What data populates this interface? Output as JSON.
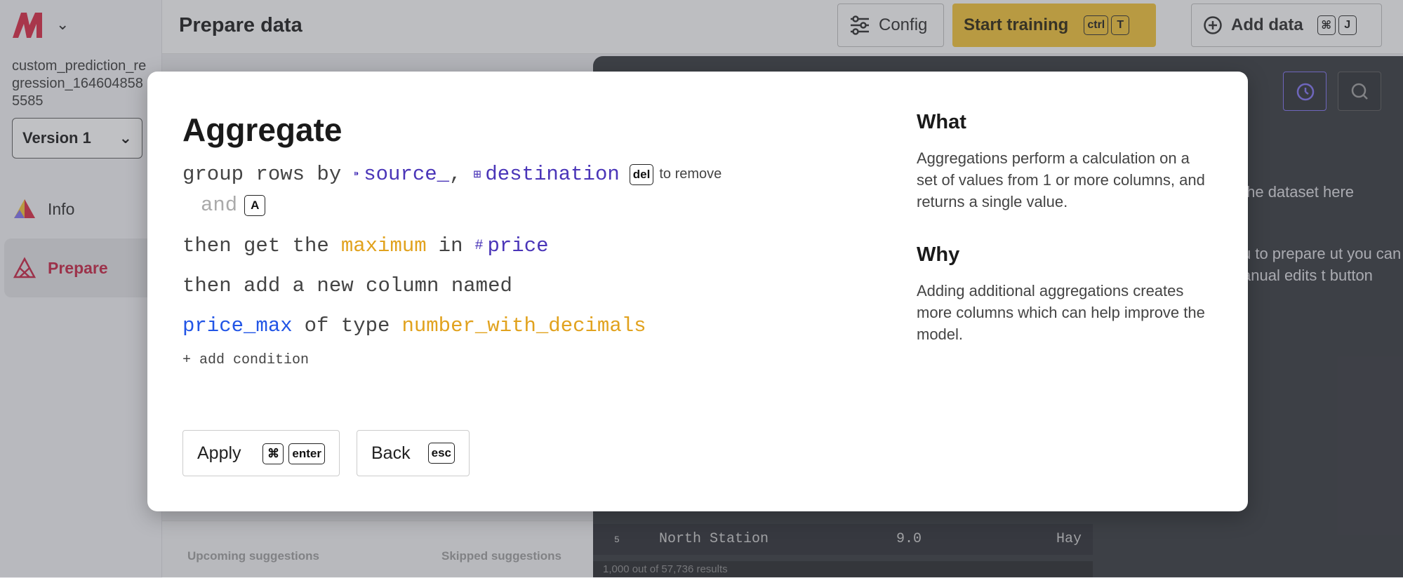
{
  "app": {
    "project_name": "custom_prediction_regression_1646048585585",
    "version": "Version 1",
    "nav": [
      {
        "label": "Info",
        "icon": "info-triangle-icon"
      },
      {
        "label": "Prepare",
        "icon": "prepare-icon",
        "active": true
      }
    ]
  },
  "header": {
    "title": "Prepare data",
    "config_label": "Config",
    "train_label": "Start training",
    "train_keys": [
      "ctrl",
      "T"
    ],
    "add_label": "Add data",
    "add_keys": [
      "⌘",
      "J"
    ]
  },
  "background": {
    "panel_text_1": "the dataset here",
    "panel_text_2": "u to prepare ut you can anual edits t button",
    "row": {
      "index": "5",
      "city": "North Station",
      "value": "9.0",
      "other": "Hay"
    },
    "footer": "1,000 out of 57,736 results",
    "tabs": [
      "Upcoming suggestions",
      "Skipped suggestions"
    ]
  },
  "modal": {
    "title": "Aggregate",
    "group_by_text": "group rows by",
    "group_cols": [
      "source_",
      "destination"
    ],
    "comma": ",",
    "remove_key": "del",
    "remove_hint": "to remove",
    "and_text": "and",
    "and_key": "A",
    "line3_pre": "then get the",
    "function": "maximum",
    "line3_in": "in",
    "target_col": "price",
    "line4": "then add a new column named",
    "new_col": "price_max",
    "line5_mid": "of type",
    "new_type": "number_with_decimals",
    "add_condition": "+ add condition",
    "apply_label": "Apply",
    "apply_keys": [
      "⌘",
      "enter"
    ],
    "back_label": "Back",
    "back_key": "esc",
    "what_heading": "What",
    "what_text": "Aggregations perform a calculation on a set of values from 1 or more columns, and returns a single value.",
    "why_heading": "Why",
    "why_text": "Adding additional aggregations creates more columns which can help improve the model."
  },
  "colors": {
    "accent_yellow": "#f2c12e",
    "prepare_red": "#c5193b",
    "column_purple": "#4a35b8",
    "function_orange": "#e1a21e",
    "new_column_blue": "#2255e6"
  }
}
